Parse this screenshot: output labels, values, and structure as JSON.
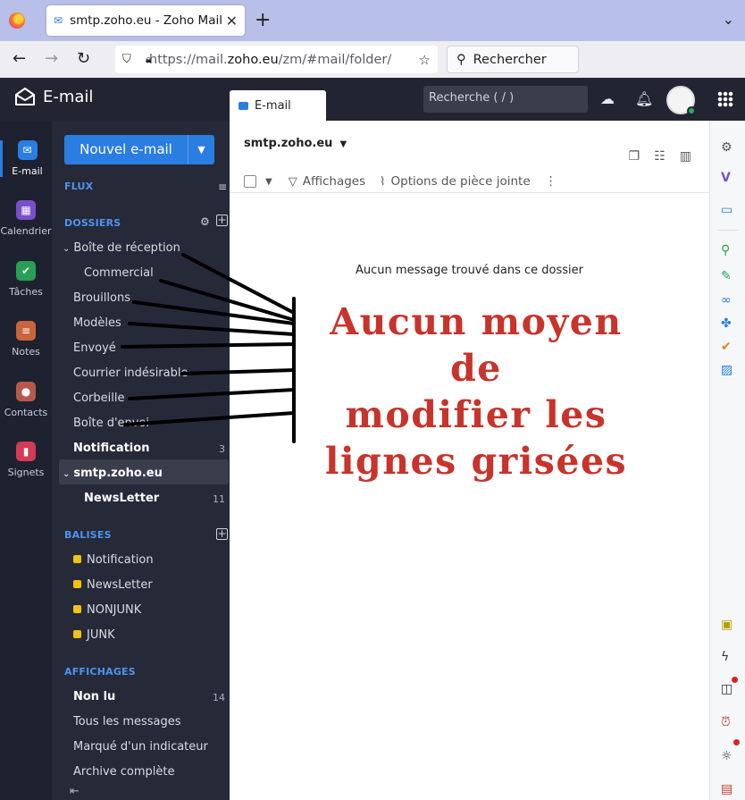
{
  "browser": {
    "tab_title": "smtp.zoho.eu - Zoho Mail",
    "url_prefix": "https://mail.",
    "url_domain": "zoho.eu",
    "url_suffix": "/zm/#mail/folder/",
    "search_placeholder": "Rechercher"
  },
  "app": {
    "brand": "E-mail",
    "tab_label": "E-mail",
    "search_placeholder": "Recherche ( / )"
  },
  "rail": [
    {
      "label": "E-mail",
      "color": "#2a7de1",
      "icon": "mail-icon",
      "glyph": "✉"
    },
    {
      "label": "Calendrier",
      "color": "#7b4fc9",
      "icon": "calendar-icon",
      "glyph": "▦"
    },
    {
      "label": "Tâches",
      "color": "#27a055",
      "icon": "tasks-icon",
      "glyph": "✔"
    },
    {
      "label": "Notes",
      "color": "#c8653a",
      "icon": "notes-icon",
      "glyph": "≡"
    },
    {
      "label": "Contacts",
      "color": "#b55a4a",
      "icon": "contacts-icon",
      "glyph": "●"
    },
    {
      "label": "Signets",
      "color": "#d23a55",
      "icon": "bookmark-icon",
      "glyph": "▮"
    }
  ],
  "sidebar": {
    "new_mail": "Nouvel e-mail",
    "flux": "FLUX",
    "dossiers": "DOSSIERS",
    "folders": [
      {
        "label": "Boîte de réception"
      },
      {
        "label": "Commercial"
      },
      {
        "label": "Brouillons"
      },
      {
        "label": "Modèles"
      },
      {
        "label": "Envoyé"
      },
      {
        "label": "Courrier indésirable"
      },
      {
        "label": "Corbeille"
      },
      {
        "label": "Boîte d'envoi"
      },
      {
        "label": "Notification",
        "count": "3"
      }
    ],
    "account": {
      "label": "smtp.zoho.eu",
      "sub": "NewsLetter",
      "sub_count": "11"
    },
    "balises": "BALISES",
    "tags": [
      "Notification",
      "NewsLetter",
      "NONJUNK",
      "JUNK"
    ],
    "affichages": "AFFICHAGES",
    "views": [
      {
        "label": "Non lu",
        "count": "14"
      },
      {
        "label": "Tous les messages"
      },
      {
        "label": "Marqué d'un indicateur"
      },
      {
        "label": "Archive complète"
      }
    ]
  },
  "main": {
    "account_title": "smtp.zoho.eu",
    "toolbar": {
      "views": "Affichages",
      "attach": "Options de pièce jointe"
    },
    "empty_message": "Aucun message trouvé dans ce dossier"
  },
  "annotation": {
    "line1": "Aucun moyen de",
    "line2": "modifier les",
    "line3": "lignes grisées",
    "color": "#c8332b"
  }
}
